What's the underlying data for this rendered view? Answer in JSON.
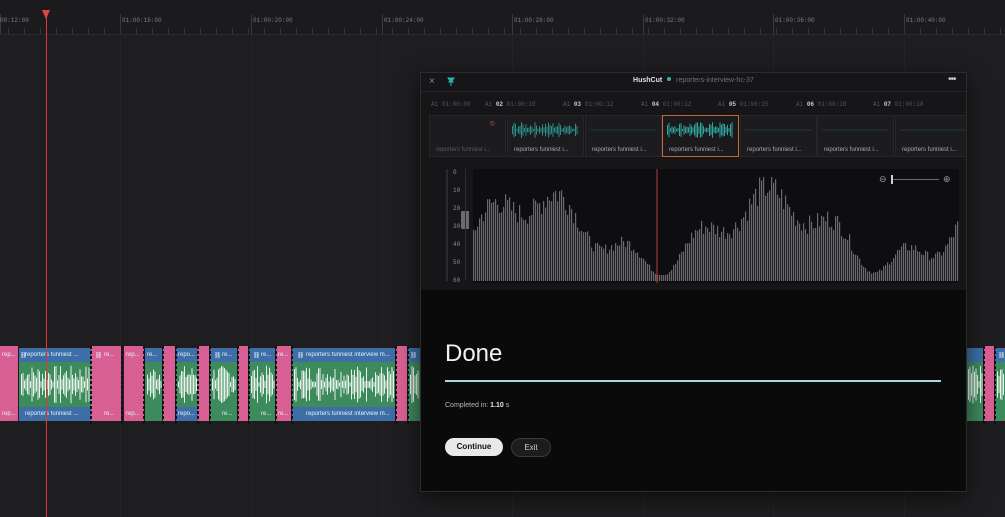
{
  "timeline": {
    "ruler_labels": [
      "00:12:00",
      "01:00:16:00",
      "01:00:20:00",
      "01:00:24:00",
      "01:00:28:00",
      "01:00:32:00",
      "01:00:36:00",
      "01:00:40:00"
    ],
    "clip_labels": {
      "short_a": "rep...",
      "long_a": "reporters funniest ...",
      "short_b": "re...",
      "short_c": "rep...",
      "short_d": "re...",
      "short_e": "repo...",
      "short_f": "re...",
      "short_g": "re...",
      "short_h": "re...",
      "long_b": "reporters funniest interview m...",
      "long_c": "reporters funniest interview m..."
    }
  },
  "dialog": {
    "app_name": "HushCut",
    "project_name": "reporters-interview-hc-37",
    "thumbnails": [
      {
        "num": "01",
        "time": "01:00:00",
        "label": "reporters funniest i..."
      },
      {
        "num": "02",
        "time": "01:00:10",
        "label": "reporters funniest i..."
      },
      {
        "num": "03",
        "time": "01:00:12",
        "label": "reporters funniest i..."
      },
      {
        "num": "04",
        "time": "01:00:12",
        "label": "reporters funniest i..."
      },
      {
        "num": "05",
        "time": "01:00:15",
        "label": "reporters funniest i..."
      },
      {
        "num": "06",
        "time": "01:00:18",
        "label": "reporters funniest i..."
      },
      {
        "num": "07",
        "time": "01:00:18",
        "label": "reporters funniest i..."
      }
    ],
    "track_tag": "A1",
    "db_labels": [
      "0",
      "10",
      "20",
      "30",
      "40",
      "50",
      "60"
    ],
    "done_title": "Done",
    "completed_prefix": "Completed in: ",
    "completed_value": "1.10",
    "completed_unit": " s",
    "continue_label": "Continue",
    "exit_label": "Exit",
    "progress": 1.0,
    "colors": {
      "accent": "#a8d8e0",
      "playhead": "#d83a3a",
      "clip_pink": "#d85f93",
      "clip_blue": "#3d6fa6",
      "clip_green": "#3d8a5d",
      "active_thumb": "#c7673a"
    },
    "icons": {
      "close": "close-icon",
      "pin": "pin-icon",
      "more": "more-icon",
      "zoom_out": "zoom-out-icon",
      "zoom_in": "zoom-in-icon",
      "status_dot": "status-dot-icon"
    }
  }
}
